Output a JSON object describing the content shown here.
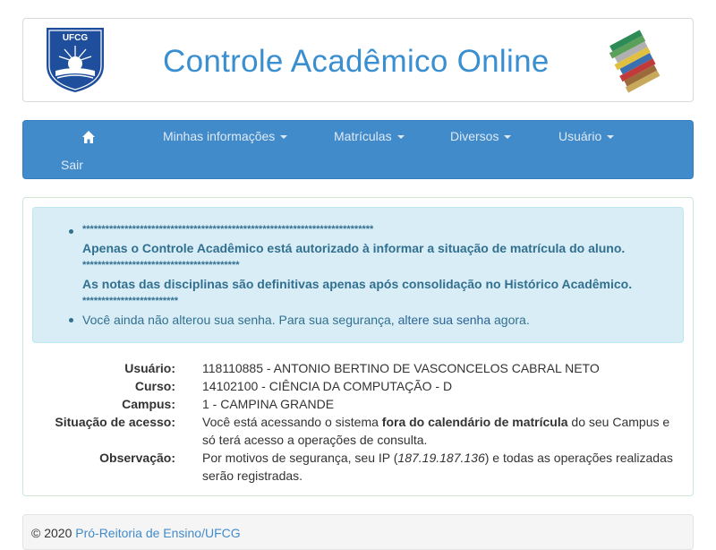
{
  "header": {
    "title": "Controle Acadêmico Online",
    "logo_left_text": "UFCG"
  },
  "nav": {
    "items": [
      {
        "label": "Minhas informações"
      },
      {
        "label": "Matrículas"
      },
      {
        "label": "Diversos"
      },
      {
        "label": "Usuário"
      }
    ],
    "logout_label": "Sair",
    "home_icon": "home-icon"
  },
  "alert": {
    "stars1": "****************************************************************************",
    "line1": "Apenas o Controle Acadêmico está autorizado à informar a situação de matrícula do aluno.",
    "stars2": "*****************************************",
    "line2": "As notas das disciplinas são definitivas apenas após consolidação no Histórico Acadêmico.",
    "stars3": "*************************",
    "pwd_prefix": "Você ainda não alterou sua senha. Para sua segurança,",
    "pwd_link": "altere sua senha",
    "pwd_suffix": "agora."
  },
  "info": {
    "user_label": "Usuário:",
    "user_value": "118110885 - ANTONIO BERTINO DE VASCONCELOS CABRAL NETO",
    "course_label": "Curso:",
    "course_value": "14102100 - CIÊNCIA DA COMPUTAÇÃO - D",
    "campus_label": "Campus:",
    "campus_value": "1 - CAMPINA GRANDE",
    "access_label": "Situação de acesso:",
    "access_prefix": "Você está acessando o sistema",
    "access_bold": "fora do calendário de matrícula",
    "access_suffix": "do seu Campus e só terá acesso a operações de consulta.",
    "obs_label": "Observação:",
    "obs_prefix": "Por motivos de segurança, seu IP (",
    "obs_ip": "187.19.187.136",
    "obs_suffix": ") e todas as operações realizadas serão registradas."
  },
  "footer": {
    "copyright": "© 2020",
    "link": "Pró-Reitoria de Ensino/UFCG"
  },
  "colors": {
    "navbar": "#428bca",
    "title": "#3a8fd0",
    "alert_bg": "#d9edf7",
    "alert_text": "#31708f"
  }
}
